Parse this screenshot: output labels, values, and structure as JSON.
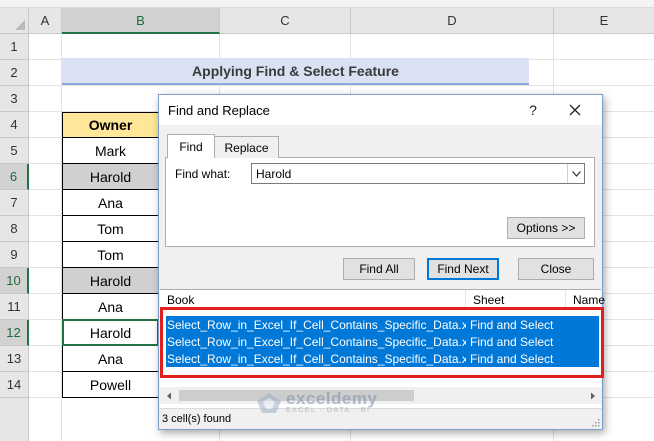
{
  "spreadsheet": {
    "columns": [
      "A",
      "B",
      "C",
      "D",
      "E"
    ],
    "rows": [
      "1",
      "2",
      "3",
      "4",
      "5",
      "6",
      "7",
      "8",
      "9",
      "10",
      "11",
      "12",
      "13",
      "14"
    ],
    "title": "Applying Find & Select Feature",
    "owner_header": "Owner",
    "owners": [
      "Mark",
      "Harold",
      "Ana",
      "Tom",
      "Tom",
      "Harold",
      "Ana",
      "Harold",
      "Ana",
      "Powell"
    ]
  },
  "dialog": {
    "title": "Find and Replace",
    "help_label": "?",
    "tabs": {
      "find": "Find",
      "replace": "Replace"
    },
    "find_what_label": "Find what:",
    "find_what_value": "Harold",
    "buttons": {
      "options": "Options >>",
      "find_all": "Find All",
      "find_next": "Find Next",
      "close": "Close"
    },
    "results": {
      "columns": [
        "Book",
        "Sheet",
        "Name"
      ],
      "rows": [
        {
          "book": "Select_Row_in_Excel_If_Cell_Contains_Specific_Data.xlsm",
          "sheet": "Find and Select"
        },
        {
          "book": "Select_Row_in_Excel_If_Cell_Contains_Specific_Data.xlsm",
          "sheet": "Find and Select"
        },
        {
          "book": "Select_Row_in_Excel_If_Cell_Contains_Specific_Data.xlsm",
          "sheet": "Find and Select"
        }
      ]
    },
    "status": "3 cell(s) found"
  },
  "watermark": {
    "name": "exceldemy",
    "tagline": "EXCEL · DATA · BI"
  },
  "colors": {
    "excel_green": "#217346",
    "title_fill": "#d9e1f2",
    "header_fill": "#ffe699",
    "match_fill": "#d0d0d0",
    "selection_blue": "#0078d7",
    "highlight_red": "#e0201c"
  },
  "icons": [
    "close-icon",
    "help-icon",
    "chevron-down-icon",
    "scroll-left-icon",
    "scroll-right-icon",
    "resize-grip-icon",
    "exceldemy-logo-icon"
  ]
}
